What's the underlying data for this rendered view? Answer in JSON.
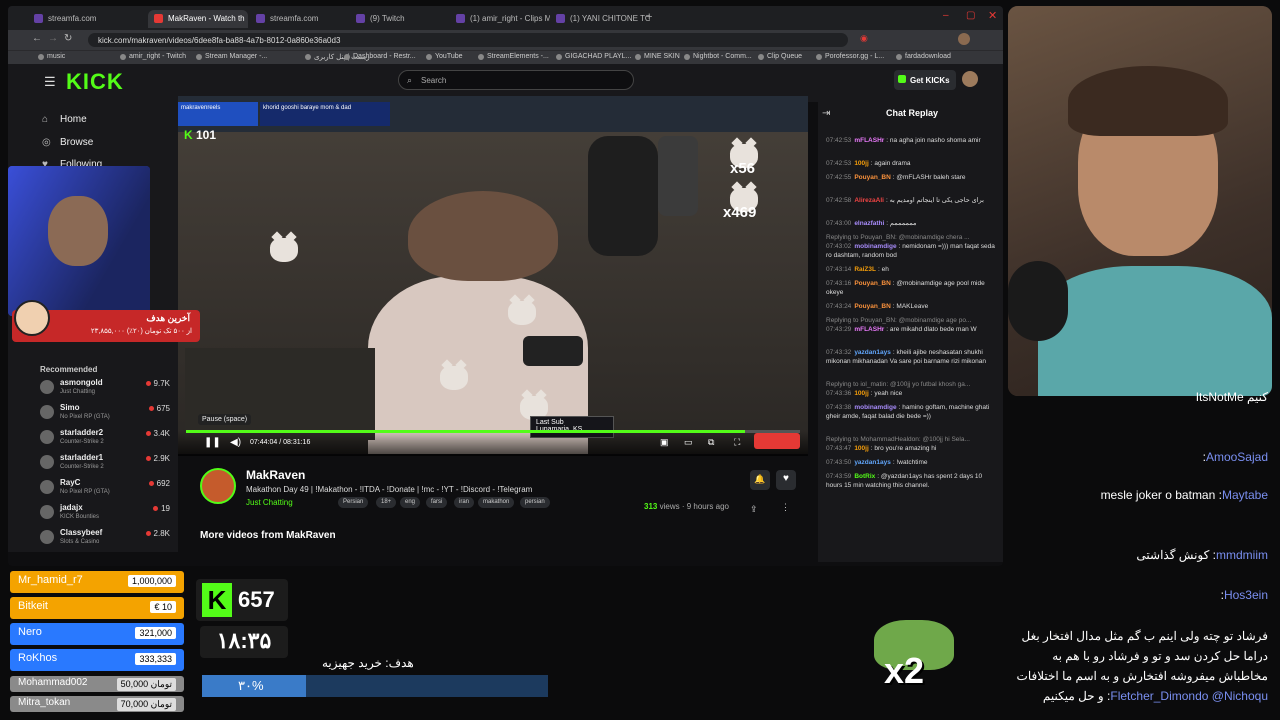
{
  "colors": {
    "accent": "#53fc18",
    "live": "#e53935",
    "donation_blue": "#2979ff",
    "donation_gray": "#8a8a8a"
  },
  "browser": {
    "tabs": [
      "streamfa.com",
      "MakRaven - Watch th",
      "streamfa.com",
      "(9) Twitch",
      "(1) amir_right - Clips Ma",
      "(1) YANI CHITONE TOSH"
    ],
    "url": "kick.com/makraven/videos/6dee8fa-ba88-4a7b-8012-0a860e36a0d3",
    "bookmarks": [
      "music",
      "amir_right - Twitch",
      "Stream Manager -...",
      "زیست | پنل کاربری",
      "Dashboard - Restr...",
      "YouTube",
      "StreamElements -...",
      "GIGACHAD PLAYL...",
      "MINE SKIN",
      "Nightbot - Comm...",
      "Clip Queue",
      "Porofessor.gg - L...",
      "fardadownload"
    ]
  },
  "kick": {
    "logo": "KICK",
    "search_placeholder": "Search",
    "get_kicks": "Get KICKs",
    "nav": [
      {
        "label": "Home",
        "icon": "home-icon"
      },
      {
        "label": "Browse",
        "icon": "compass-icon"
      },
      {
        "label": "Following",
        "icon": "heart-icon"
      }
    ],
    "recommended_title": "Recommended",
    "recommended": [
      {
        "name": "asmongold",
        "game": "Just Chatting",
        "viewers": "9.7K"
      },
      {
        "name": "Simo",
        "game": "No Pixel RP (GTA)",
        "viewers": "675"
      },
      {
        "name": "starladder2",
        "game": "Counter-Strike 2",
        "viewers": "3.4K"
      },
      {
        "name": "starladder1",
        "game": "Counter-Strike 2",
        "viewers": "2.9K"
      },
      {
        "name": "RayC",
        "game": "No Pixel RP (GTA)",
        "viewers": "692"
      },
      {
        "name": "jadajx",
        "game": "KICK Bounties",
        "viewers": "19"
      },
      {
        "name": "Classybeef",
        "game": "Slots & Casino",
        "viewers": "2.8K"
      }
    ],
    "player": {
      "tooltip": "Pause (space)",
      "time": "07:44:04 / 08:31:16",
      "kick_count": "101",
      "last_sub_label": "Last Sub",
      "last_sub_name": "Lunamaria_KS",
      "emote_count_1": "x56",
      "emote_count_2": "x469",
      "progress": 0.91,
      "overlay_name": "makravenreels",
      "overlay_text": "khorid gooshi baraye mom & dad"
    },
    "channel": {
      "name": "MakRaven",
      "title": "Makathon Day 49 | !Makathon - !ITDA - !Donate | !mc - !YT - !Discord - !Telegram",
      "category": "Just Chatting",
      "tags": [
        "Persian",
        "18+",
        "eng",
        "farsi",
        "iran",
        "makathon",
        "persian"
      ],
      "views": "313",
      "views_label": "views",
      "ago": "9 hours ago",
      "more_videos": "More videos from MakRaven"
    },
    "chat": {
      "title": "Chat Replay",
      "messages": [
        {
          "time": "07:42:53",
          "user": "mFLASHr",
          "color": "#e879f9",
          "text": "na agha join nasho shoma amir"
        },
        {
          "time": "07:42:53",
          "user": "100jj",
          "color": "#f59e0b",
          "text": "again drama"
        },
        {
          "time": "07:42:55",
          "user": "Pouyan_BN",
          "color": "#fb923c",
          "text": "@mFLASHr baleh stare"
        },
        {
          "time": "07:42:58",
          "user": "AlirezaAli",
          "color": "#ef4444",
          "text": "برای حاجی یکی تا اینجاتم اومدیم به"
        },
        {
          "time": "07:43:00",
          "user": "elnazfathi",
          "color": "#a78bfa",
          "text": "ممممممم"
        },
        {
          "time": "07:43:02",
          "user": "mobinamdige",
          "color": "#a78bfa",
          "text": "nemidonam =))) man faqat seda ro dashtam, random bod",
          "reply": "Replying to Pouyan_BN: @mobinamdige chera ..."
        },
        {
          "time": "07:43:14",
          "user": "RaiZ3L",
          "color": "#f59e0b",
          "text": "eh"
        },
        {
          "time": "07:43:16",
          "user": "Pouyan_BN",
          "color": "#fb923c",
          "text": "@mobinamdige age pool mide okeye"
        },
        {
          "time": "07:43:24",
          "user": "Pouyan_BN",
          "color": "#fb923c",
          "text": "MAKLeave"
        },
        {
          "time": "07:43:29",
          "user": "mFLASHr",
          "color": "#e879f9",
          "text": "are mikahd dlato bede man W",
          "reply": "Replying to Pouyan_BN: @mobinamdige age po..."
        },
        {
          "time": "07:43:32",
          "user": "yazdan1ays",
          "color": "#60a5fa",
          "text": "kheili ajibe neshasatan shukhi mikonan mikhanadan Va sare poi barname rizi mikonan"
        },
        {
          "time": "07:43:36",
          "user": "100jj",
          "color": "#f59e0b",
          "text": "yeah nice",
          "reply": "Replying to iol_matin: @100jj yo futbal khosh ga..."
        },
        {
          "time": "07:43:38",
          "user": "mobinamdige",
          "color": "#a78bfa",
          "text": "hamino goftam, machine ghati gheir amde, faqat balad die bede =))"
        },
        {
          "time": "07:43:47",
          "user": "100jj",
          "color": "#f59e0b",
          "text": "bro you're amazing hi",
          "reply": "Replying to MohammadHealdon: @100jj hi Sela..."
        },
        {
          "time": "07:43:50",
          "user": "yazdan1ays",
          "color": "#60a5fa",
          "text": "!watchtime"
        },
        {
          "time": "07:43:59",
          "user": "BotRix",
          "color": "#53fc18",
          "text": "@yazdan1ays has spent 2 days 10 hours 15 min watching this channel."
        }
      ]
    }
  },
  "stream_overlay": {
    "goal_title": "آخرین هدف",
    "goal_amount": "۲۳,۸۵۵,۰۰۰ از ۵۰۰ تک تومان (۲۰٪)",
    "donations": [
      {
        "name": "Mr_hamid_r7",
        "value": "1,000,000",
        "style": "gold"
      },
      {
        "name": "Bitkeit",
        "value": "€ 10",
        "style": "gold"
      },
      {
        "name": "Nero",
        "value": "321,000",
        "style": "blue"
      },
      {
        "name": "RoKhos",
        "value": "333,333",
        "style": "blue"
      },
      {
        "name": "Mohammad002",
        "value": "50,000 تومان",
        "style": "gray"
      },
      {
        "name": "Mitra_tokan",
        "value": "70,000 تومان",
        "style": "gray"
      }
    ],
    "kick_followers": "657",
    "clock": "۱۸:۳۵",
    "goal2_label": "هدف: خرید جهیزیه",
    "goal2_percent": "۳۰%",
    "goal2_fraction": 0.3,
    "x2": "x2"
  },
  "right_chat": [
    {
      "user": "",
      "text": "ItsNotMe کنیم"
    },
    {
      "user": "AmooSajad",
      "text": ""
    },
    {
      "user": "Maytabe",
      "text": "mesle joker o batman"
    },
    {
      "user": "mmdmiim",
      "text": "کونش گذاشتی"
    },
    {
      "user": "Hos3ein",
      "text": ""
    },
    {
      "user": "Fletcher_Dimondo",
      "text": "فرشاد تو چته ولی اینم ب گم مثل مدال افتخار بغل دراما حل کردن سد و تو و فرشاد رو با هم به مخاطباش میفروشه افتخارش و به اسم ما اختلافات و حل میکنیم",
      "mention": "@Nichoqu"
    }
  ]
}
